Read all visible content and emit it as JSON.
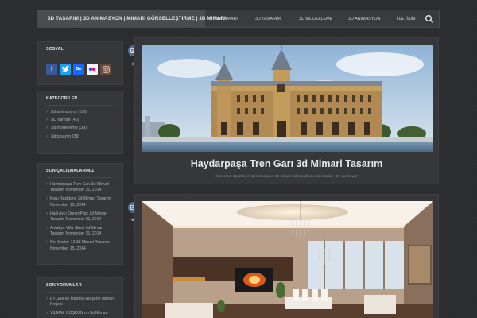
{
  "header": {
    "brand": "3D TASARIM | 3D ANIMASYON | MIMARI GÖRSELLEŞTIRME | 3D MIMARI",
    "nav": [
      "3D MIMARI",
      "3D TASARIM",
      "3D MODELLEME",
      "3D ANIMASYON",
      "İLETİŞİM"
    ]
  },
  "sidebar": {
    "sosyal": {
      "title": "SOSYAL",
      "icons": [
        "f",
        "t",
        "Be",
        "fl",
        "ig"
      ]
    },
    "kategoriler": {
      "title": "KATEGORILER",
      "items": [
        "3d animasyon (19)",
        "3D Mimari (40)",
        "3d modelleme (39)",
        "3d tasarim (39)"
      ]
    },
    "son": {
      "title": "SON ÇALIŞMALARIMIZ",
      "items": [
        "Haydarpaşa Tren Garı 3d Mimari Tasarım November 15, 2014",
        "Koru Rezidans 3d Mimari Tasarım November 15, 2014",
        "Halil Avcı DreamPark 3d Mimari Tasarım November 15, 2014",
        "Antakya Villa Sitesi 3d Mimari Tasarım November 15, 2014",
        "Nef Merter-12 3d Mimari Tasarım November 15, 2014"
      ]
    },
    "yorumlar": {
      "title": "SON YORUMLAR",
      "items": [
        "EYLEM on İstanbul Ataşehir Mimari Projesi",
        "YILMAZ COŞKUN on 3d Mimari"
      ]
    }
  },
  "posts": [
    {
      "title": "Haydarpaşa Tren Garı 3d Mimari Tasarım",
      "meta": "November 15, 2014   in   3d animasyon,   3D Mimari,   3d modelleme,   3d tasarim   •   Bir yorum yaz"
    },
    {
      "title": "",
      "meta": ""
    }
  ],
  "colors": {
    "facebook": "#3b5998",
    "twitter": "#1da1f2",
    "behance": "#1769ff",
    "flickr": "#f5f5f5",
    "instagram": "#6d4c3d",
    "accent": "#4f6f9a"
  }
}
